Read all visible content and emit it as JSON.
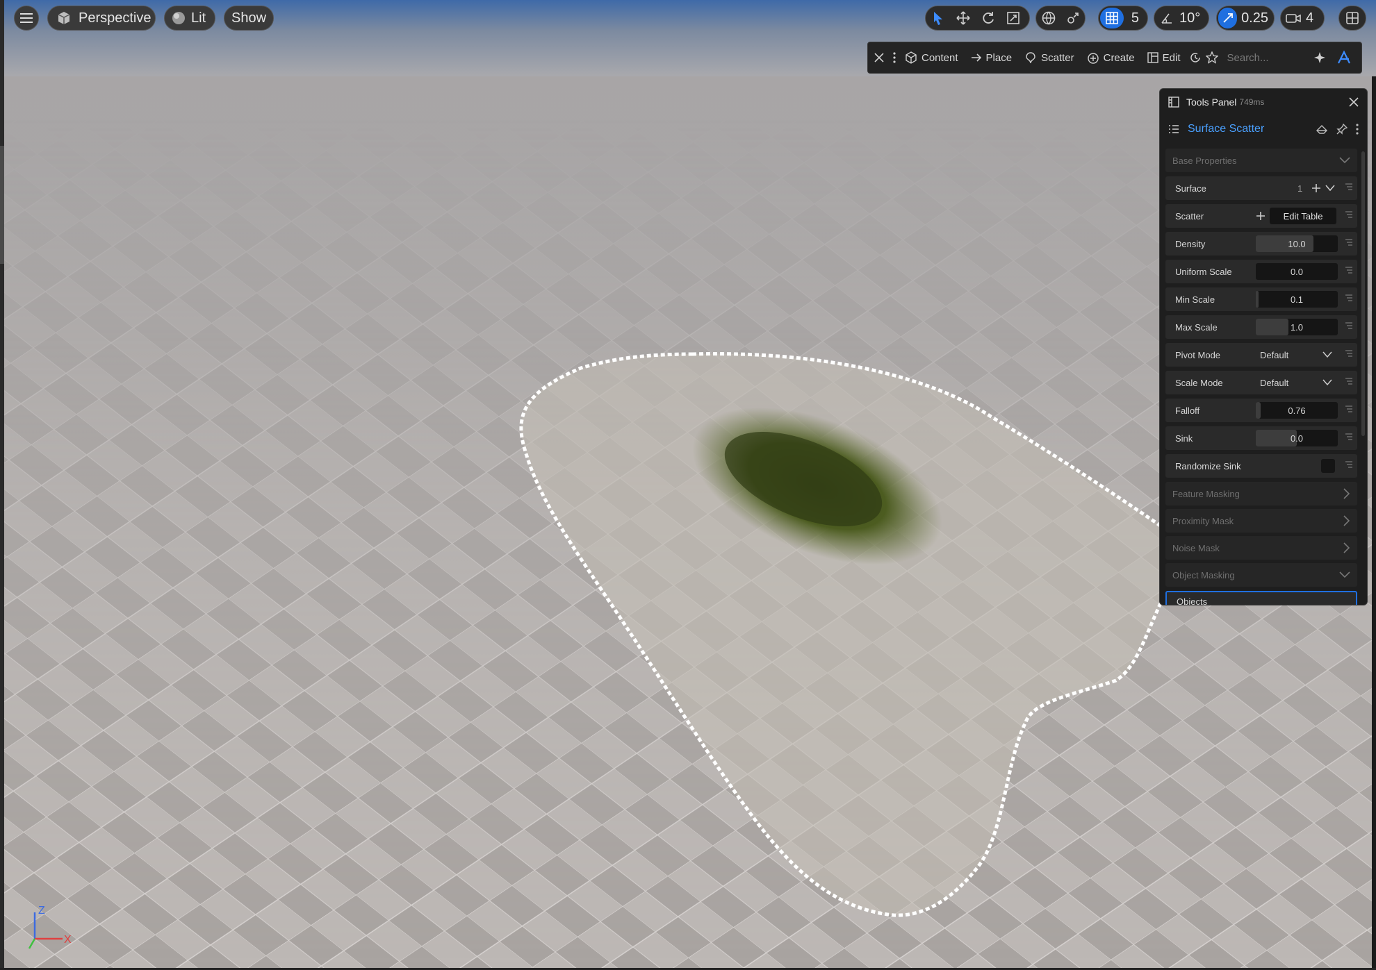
{
  "viewport_toolbar": {
    "perspective_label": "Perspective",
    "lit_label": "Lit",
    "show_label": "Show",
    "grid_snap_value": "5",
    "angle_snap_value": "10°",
    "scale_snap_value": "0.25",
    "camera_speed_value": "4"
  },
  "mode_bar": {
    "items": [
      "Content",
      "Place",
      "Scatter",
      "Create",
      "Edit"
    ],
    "search_placeholder": "Search..."
  },
  "tools_panel": {
    "title": "Tools Panel",
    "time": "749ms",
    "tool_name": "Surface Scatter",
    "sections": {
      "base": "Base Properties",
      "feature_masking": "Feature Masking",
      "proximity_mask": "Proximity Mask",
      "noise_mask": "Noise Mask",
      "object_masking": "Object Masking"
    },
    "surface": {
      "label": "Surface",
      "count": "1"
    },
    "scatter": {
      "label": "Scatter",
      "button": "Edit Table"
    },
    "density": {
      "label": "Density",
      "value": "10.0",
      "fill": 0.7
    },
    "uniform_scale": {
      "label": "Uniform Scale",
      "value": "0.0",
      "fill": 0.0
    },
    "min_scale": {
      "label": "Min Scale",
      "value": "0.1",
      "fill": 0.03
    },
    "max_scale": {
      "label": "Max Scale",
      "value": "1.0",
      "fill": 0.4
    },
    "pivot_mode": {
      "label": "Pivot Mode",
      "value": "Default"
    },
    "scale_mode": {
      "label": "Scale Mode",
      "value": "Default"
    },
    "falloff": {
      "label": "Falloff",
      "value": "0.76",
      "fill": 0.06
    },
    "sink": {
      "label": "Sink",
      "value": "0.0",
      "fill": 0.5
    },
    "randomize_sink": {
      "label": "Randomize Sink"
    },
    "objects": {
      "label": "Objects"
    }
  },
  "axis": {
    "z": "Z",
    "x": "X"
  },
  "colors": {
    "accent": "#1f6fe0",
    "accent_text": "#4aa0ff",
    "panel_bg": "#1e1e1e"
  }
}
